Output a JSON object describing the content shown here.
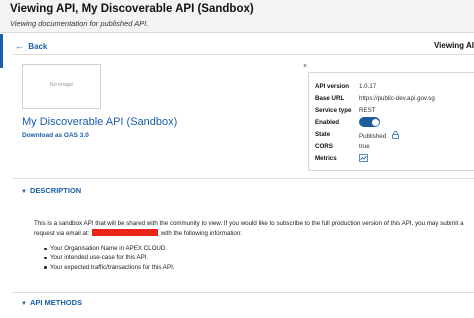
{
  "header": {
    "title": "Viewing API, My Discoverable API (Sandbox)",
    "subtitle": "Viewing documentation for published API."
  },
  "nav": {
    "back_label": "Back",
    "viewing_label": "Viewing AI"
  },
  "api": {
    "image_placeholder": "No image",
    "name": "My Discoverable API (Sandbox)",
    "download_label": "Download as OAS 3.0"
  },
  "close_label": "×",
  "info": {
    "rows": [
      {
        "label": "API version",
        "value": "1.0.17"
      },
      {
        "label": "Base URL",
        "value": "https://public-dev.api.gov.sg"
      },
      {
        "label": "Service type",
        "value": "REST"
      },
      {
        "label": "Enabled",
        "value": "",
        "enabled": true
      },
      {
        "label": "State",
        "value": "Published"
      },
      {
        "label": "CORS",
        "value": "true"
      },
      {
        "label": "Metrics",
        "value": ""
      }
    ]
  },
  "sections": {
    "description_title": "DESCRIPTION",
    "methods_title": "API METHODS"
  },
  "description": {
    "para_1": "This is a sandbox API that will be shared with the community to view. If you would like to subscribe to the full production version of this API, you may submit a",
    "para_2a": "request via email at:",
    "para_2b": "with the following information:",
    "bullets": [
      "Your Organisation Name in APEX CLOUD.",
      "Your intended use-case for this API.",
      "Your expected traffic/transactions for this API."
    ]
  },
  "colors": {
    "link": "#1a5fa8",
    "toggle_on": "#1f5f9e",
    "redaction": "#e8241b"
  }
}
